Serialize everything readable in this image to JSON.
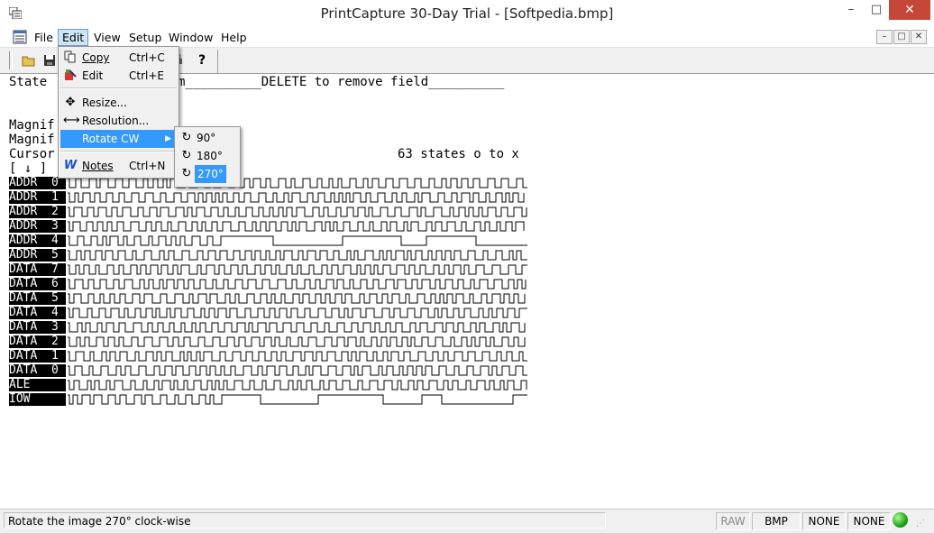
{
  "window": {
    "title": "PrintCapture 30-Day Trial - [Softpedia.bmp]",
    "minimize_glyph": "–",
    "maximize_glyph": "□",
    "close_glyph": "✕"
  },
  "menubar": {
    "items": [
      "File",
      "Edit",
      "View",
      "Setup",
      "Window",
      "Help"
    ],
    "mdi_buttons": [
      "–",
      "□",
      "✕"
    ]
  },
  "toolbar": {
    "icons": [
      "open-folder-icon",
      "save-disk-icon",
      "print-icon",
      "help-icon"
    ],
    "help_glyph": "?"
  },
  "canvas": {
    "line1_left": "State",
    "line1_right": "m__________DELETE to remove field__________",
    "line2": "Magnif",
    "line3": "Magnif",
    "line4": "Cursor",
    "line5": "[ ↓ ]",
    "states_text": "63 states o to x",
    "signals": [
      "ADDR  0",
      "ADDR  1",
      "ADDR  2",
      "ADDR  3",
      "ADDR  4",
      "ADDR  5",
      "DATA  7",
      "DATA  6",
      "DATA  5",
      "DATA  4",
      "DATA  3",
      "DATA  2",
      "DATA  1",
      "DATA  0",
      "ALE",
      "IOW"
    ]
  },
  "edit_menu": {
    "items": [
      {
        "label": "Copy",
        "shortcut": "Ctrl+C",
        "icon": "copy-icon"
      },
      {
        "label": "Edit",
        "shortcut": "Ctrl+E",
        "icon": "edit-paint-icon"
      },
      {
        "label": "Resize...",
        "shortcut": "",
        "icon": "resize-arrows-icon"
      },
      {
        "label": "Resolution...",
        "shortcut": "",
        "icon": "resolution-arrow-icon"
      },
      {
        "label": "Rotate CW",
        "shortcut": "",
        "icon": ""
      },
      {
        "label": "Notes",
        "shortcut": "Ctrl+N",
        "icon": "notes-w-icon"
      }
    ],
    "submenu_arrow": "▶"
  },
  "rotate_submenu": {
    "items": [
      "90°",
      "180°",
      "270°"
    ],
    "highlighted": "270°"
  },
  "statusbar": {
    "message": "Rotate the image 270° clock-wise",
    "panes": [
      "RAW",
      "BMP",
      "NONE",
      "NONE"
    ]
  }
}
